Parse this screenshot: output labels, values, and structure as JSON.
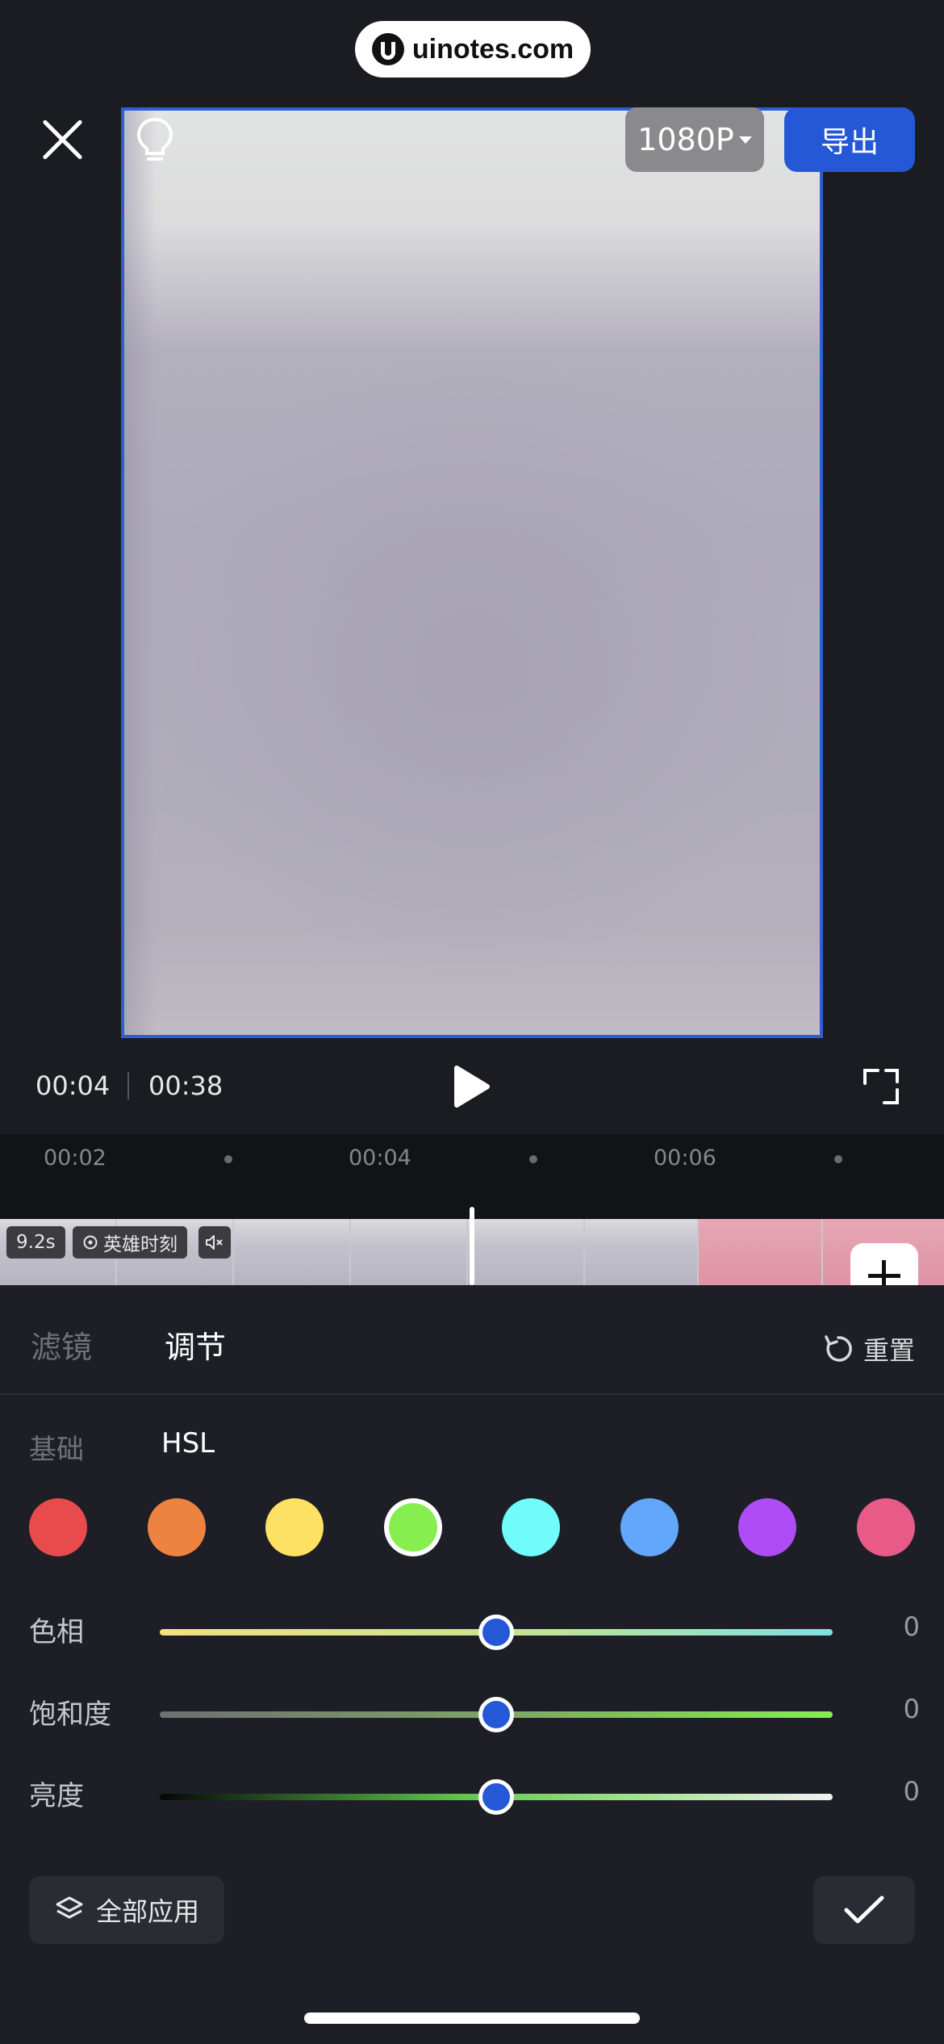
{
  "watermark": {
    "text": "uinotes.com"
  },
  "header": {
    "close_icon": "close-icon",
    "resolution_label": "1080P",
    "export_label": "导出",
    "accent_color": "#2458d6"
  },
  "player": {
    "current_time": "00:04",
    "total_time": "00:38"
  },
  "timeline": {
    "ticks": [
      "00:02",
      "00:04",
      "00:06"
    ],
    "clip_duration": "9.2s",
    "clip_tag": "英雄时刻"
  },
  "panel": {
    "tabs": [
      {
        "label": "滤镜",
        "active": false
      },
      {
        "label": "调节",
        "active": true
      }
    ],
    "reset_label": "重置",
    "subtabs": [
      {
        "label": "基础",
        "active": false
      },
      {
        "label": "HSL",
        "active": true
      }
    ],
    "swatches": [
      {
        "name": "red",
        "color": "#e84b4b",
        "selected": false
      },
      {
        "name": "orange",
        "color": "#ee8341",
        "selected": false
      },
      {
        "name": "yellow",
        "color": "#fde164",
        "selected": false
      },
      {
        "name": "green",
        "color": "#86ee4f",
        "selected": true
      },
      {
        "name": "cyan",
        "color": "#6ffcfb",
        "selected": false
      },
      {
        "name": "blue",
        "color": "#62a7fb",
        "selected": false
      },
      {
        "name": "purple",
        "color": "#ae4cf5",
        "selected": false
      },
      {
        "name": "pink",
        "color": "#e85b87",
        "selected": false
      }
    ],
    "sliders": [
      {
        "label": "色相",
        "value": "0",
        "position": 0.5
      },
      {
        "label": "饱和度",
        "value": "0",
        "position": 0.5
      },
      {
        "label": "亮度",
        "value": "0",
        "position": 0.5
      }
    ],
    "apply_all_label": "全部应用"
  }
}
